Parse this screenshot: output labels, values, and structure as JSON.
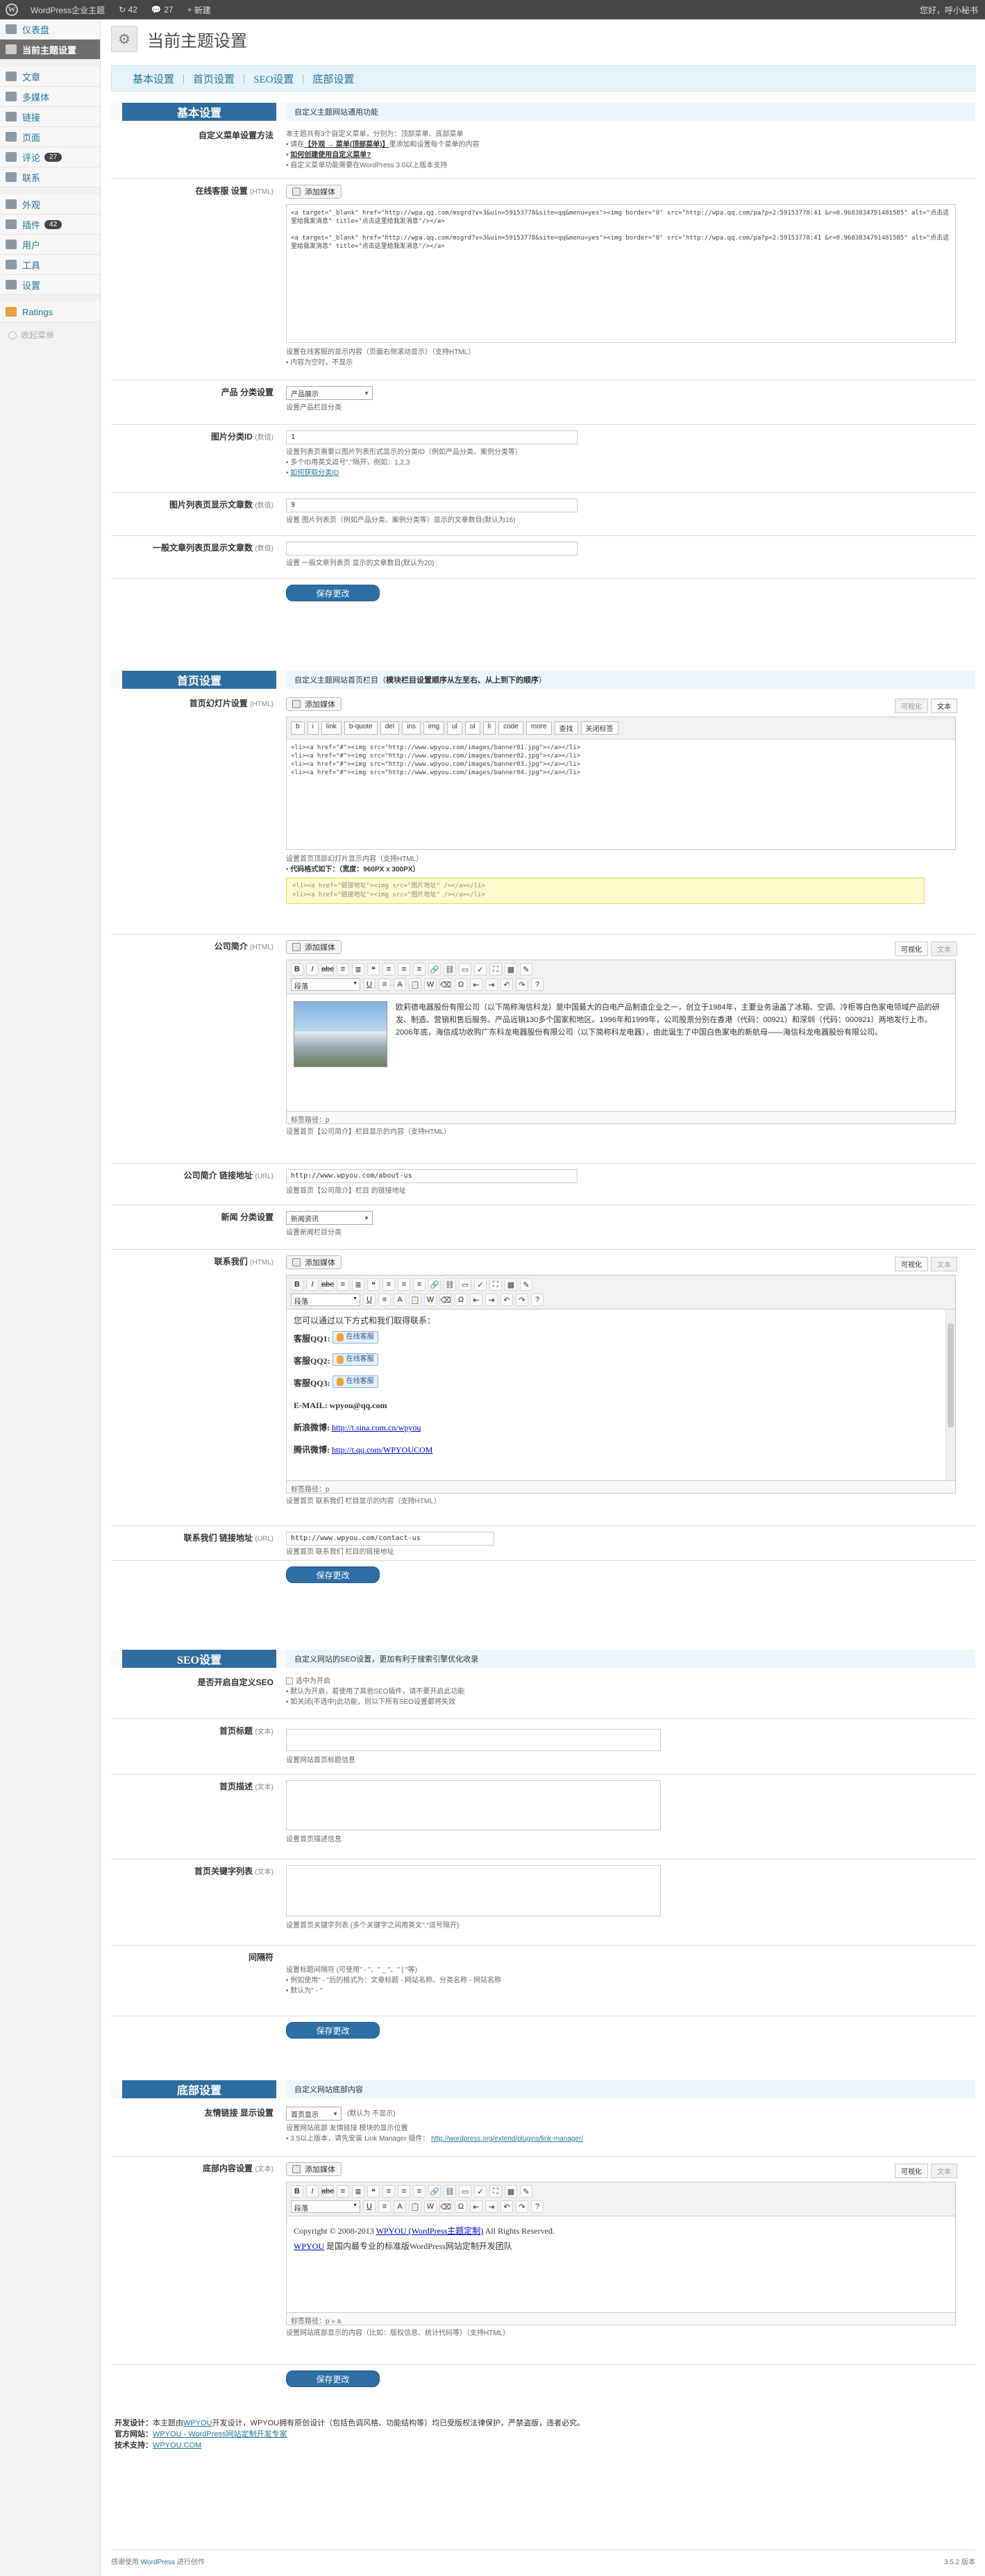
{
  "adminbar": {
    "site": "WordPress企业主题",
    "updates": "42",
    "comments": "27",
    "new": "新建",
    "howdy": "您好，呼小秘书"
  },
  "sidebar": {
    "items": [
      {
        "label": "仪表盘",
        "badge": ""
      },
      {
        "label": "当前主题设置",
        "badge": ""
      },
      {
        "label": "文章",
        "badge": ""
      },
      {
        "label": "多媒体",
        "badge": ""
      },
      {
        "label": "链接",
        "badge": ""
      },
      {
        "label": "页面",
        "badge": ""
      },
      {
        "label": "评论",
        "badge": "27"
      },
      {
        "label": "联系",
        "badge": ""
      },
      {
        "label": "外观",
        "badge": ""
      },
      {
        "label": "插件",
        "badge": "42"
      },
      {
        "label": "用户",
        "badge": ""
      },
      {
        "label": "工具",
        "badge": ""
      },
      {
        "label": "设置",
        "badge": ""
      },
      {
        "label": "Ratings",
        "badge": ""
      }
    ],
    "collapse": "收起菜单"
  },
  "page": {
    "title": "当前主题设置"
  },
  "tabs": [
    "基本设置",
    "首页设置",
    "SEO设置",
    "底部设置"
  ],
  "basic": {
    "heading": "基本设置",
    "desc": "自定义主题网站通用功能",
    "menu_label": "自定义菜单设置方法",
    "menu_line1": "本主题共有3个自定义菜单，分别为：",
    "menu_line1b": "顶部菜单、底部菜单",
    "menu_line2a": "请在",
    "menu_line2_link": "【外观 → 菜单(顶部菜单)】",
    "menu_line2b": "里添加和设置每个菜单的内容",
    "menu_line3": "如何创建使用自定义菜单?",
    "menu_line4": "自定义菜单功能需要在WordPress 3.0以上版本支持",
    "cs_label": "在线客服 设置",
    "cs_sub": "(HTML)",
    "add_media": "添加媒体",
    "cs_code1": "<a target=\"_blank\" href=\"http://wpa.qq.com/msgrd?v=3&uin=59153778&site=qq&menu=yes\"><img border=\"0\" src=\"http://wpa.qq.com/pa?p=2:59153778:41 &r=0.9683834791481585\" alt=\"点击这里给我发消息\" title=\"点击这里给我发消息\"/></a>",
    "cs_code2": "<a target=\"_blank\" href=\"http://wpa.qq.com/msgrd?v=3&uin=59153778&site=qq&menu=yes\"><img border=\"0\" src=\"http://wpa.qq.com/pa?p=2:59153778:41 &r=0.9683834791481585\" alt=\"点击这里给我发消息\" title=\"点击这里给我发消息\"/></a>",
    "cs_note1": "设置在线客服的显示内容（页面右侧滚动显示）（支持HTML）",
    "cs_note2": "内容为空时，不显示",
    "prod_label": "产品 分类设置",
    "prod_select": "产品展示",
    "prod_note": "设置产品栏目分类",
    "img_label": "图片分类ID",
    "img_sub": "(数值)",
    "img_value": "1",
    "img_note1": "设置列表页需要以图片列表形式显示的分类ID（例如产品分类、案例分类等）",
    "img_note2": "多个ID用英文逗号\",\"隔开，例如：1,2,3",
    "img_note3": "如何获取分类ID",
    "imgcount_label": "图片列表页显示文章数",
    "imgcount_sub": "(数值)",
    "imgcount_value": "9",
    "imgcount_note": "设置 图片列表页（例如产品分类、案例分类等）显示的文章数目(默认为16)",
    "listcount_label": "一般文章列表页显示文章数",
    "listcount_sub": "(数值)",
    "listcount_value": "",
    "listcount_note": "设置 一般文章列表页 显示的文章数目(默认为20)",
    "save": "保存更改"
  },
  "home": {
    "heading": "首页设置",
    "desc": "自定义主题网站首页栏目（",
    "desc_b": "模块栏目设置顺序从左至右、从上到下的顺序",
    "desc_c": "）",
    "slider_label": "首页幻灯片设置",
    "slider_sub": "(HTML)",
    "visual": "可视化",
    "text": "文本",
    "qt_buttons": [
      "b",
      "i",
      "link",
      "b-quote",
      "del",
      "ins",
      "img",
      "ul",
      "ol",
      "li",
      "code",
      "more",
      "查找",
      "关闭标签"
    ],
    "slider_lines": [
      "<li><a href=\"#\"><img src=\"http://www.wpyou.com/images/banner01.jpg\"></a></li>",
      "<li><a href=\"#\"><img src=\"http://www.wpyou.com/images/banner02.jpg\"></a></li>",
      "<li><a href=\"#\"><img src=\"http://www.wpyou.com/images/banner03.jpg\"></a></li>",
      "<li><a href=\"#\"><img src=\"http://www.wpyou.com/images/banner04.jpg\"></a></li>"
    ],
    "slider_note1": "设置首页顶部幻灯片显示内容（支持HTML）",
    "slider_note2": "代码格式如下：（宽度：960PX x 300PX）",
    "slider_code": [
      "<li><a href=\"链接地址\"><img src=\"图片地址\" /></a></li>",
      "<li><a href=\"链接地址\"><img src=\"图片地址\" /></a></li>"
    ],
    "intro_label": "公司简介",
    "intro_sub": "(HTML)",
    "para": "段落",
    "intro_text": "欧莉德电器股份有限公司（以下简称海信科龙）是中国最大的白电产品制造企业之一，创立于1984年，主要业务涵盖了冰箱、空调、冷柜等白色家电领域产品的研发、制造、营销和售后服务。产品远销130多个国家和地区。1996年和1999年，公司股票分别在香港（代码：00921）和深圳（代码：000921）两地发行上市。2006年底，海信成功收购广东科龙电器股份有限公司（以下简称科龙电器），由此诞生了中国白色家电的新航母——海信科龙电器股份有限公司。",
    "intro_path": "标签路径：p",
    "intro_note": "设置首页【公司简介】栏目显示的内容（支持HTML）",
    "introurl_label": "公司简介 链接地址",
    "introurl_sub": "(URL)",
    "introurl_value": "http://www.wpyou.com/about-us",
    "introurl_note": "设置首页【公司简介】栏目 的链接地址",
    "news_label": "新闻 分类设置",
    "news_select": "新闻资讯",
    "news_note": "设置新闻栏目分类",
    "contact_label": "联系我们",
    "contact_sub": "(HTML)",
    "contact_intro": "您可以通过以下方式和我们取得联系：",
    "contact_qq": [
      "客服QQ1:",
      "客服QQ2:",
      "客服QQ3:"
    ],
    "qq_btn": "在线客服",
    "contact_email": "E-MAIL: wpyou@qq.com",
    "contact_sina_label": "新浪微博:",
    "contact_sina": "http://t.sina.com.cn/wpyou",
    "contact_tx_label": "腾讯微博:",
    "contact_tx": "http://t.qq.com/WPYOUCOM",
    "contact_path": "标签路径：p",
    "contact_note": "设置首页 联系我们 栏目显示的内容（支持HTML）",
    "contacturl_label": "联系我们 链接地址",
    "contacturl_sub": "(URL)",
    "contacturl_value": "http://www.wpyou.com/contact-us",
    "contacturl_note": "设置首页 联系我们 栏目的链接地址",
    "save": "保存更改"
  },
  "seo": {
    "heading": "SEO设置",
    "desc": "自定义网站的SEO设置，更加有利于搜索引擎优化收录",
    "enable_label": "是否开启自定义SEO",
    "enable_check": "选中为开启",
    "enable_note1": "默认为开启，若使用了其他SEO插件，请不要开启此功能",
    "enable_note2": "如关闭(不选中)此功能，则以下所有SEO设置都将失效",
    "title_label": "首页标题",
    "title_sub": "(文本)",
    "title_note": "设置网站首页标题信息",
    "desc_label": "首页描述",
    "desc_sub": "(文本)",
    "desc_note": "设置首页描述信息",
    "kw_label": "首页关键字列表",
    "kw_sub": "(文本)",
    "kw_note": "设置首页关键字列表 (多个关键字之间用英文\",\"逗号隔开)",
    "sep_label": "间隔符",
    "sep_note1": "设置标题间隔符 (可使用\" - \"、\" _ \"、\" | \"等)",
    "sep_note2": "例如使用\" - \"后的格式为：文章标题 - 网站名称、分类名称 - 网站名称",
    "sep_note3": "默认为\" - \"",
    "save": "保存更改"
  },
  "footer": {
    "heading": "底部设置",
    "desc": "自定义网站底部内容",
    "links_label": "友情链接 显示设置",
    "links_select": "首页显示",
    "links_default": "(默认为 不显示)",
    "links_note1": "设置网站底部 友情链接 模块的显示位置",
    "links_note2": "3.5以上版本，请先安装 Link Manager 插件：",
    "links_note2_link": "http://wordpress.org/extend/plugins/link-manager/",
    "content_label": "底部内容设置",
    "content_sub": "(文本)",
    "copyright_a": "Copyright © 2008-2013 ",
    "copyright_link": "WPYOU (WordPress主题定制)",
    "copyright_b": " All Rights Reserved.",
    "line2_link": "WPYOU",
    "line2": " 是国内最专业的标准版WordPress网站定制开发团队",
    "content_path": "标签路径：p » a",
    "content_note": "设置网站底部显示的内容（比如：版权信息、统计代码等）（支持HTML）",
    "save": "保存更改"
  },
  "credits": {
    "line1_label": "开发设计：",
    "line1a": "本主题由",
    "line1_link": "WPYOU",
    "line1b": "开发设计，WPYOU拥有原创设计（包括色调风格、功能结构等）均已受版权法律保护，严禁盗版，违者必究。",
    "line2_label": "官方网站：",
    "line2_link": "WPYOU - WordPress网站定制开发专家",
    "line3_label": "技术支持：",
    "line3_link": "WPYOU.COM"
  },
  "bottom": {
    "thanks": "感谢使用 ",
    "thanks_link": "WordPress",
    "thanks_b": " 进行创作",
    "version": "3.5.2 版本"
  }
}
